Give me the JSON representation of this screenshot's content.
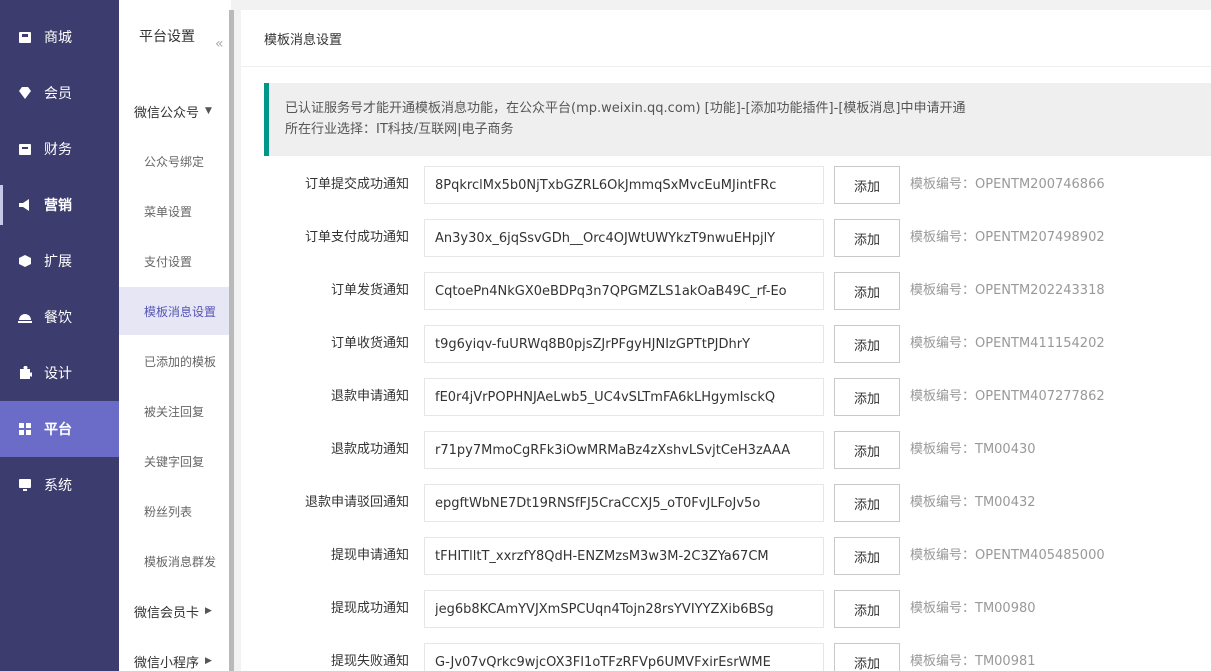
{
  "main_nav": [
    {
      "label": "商城",
      "icon": "shop-icon"
    },
    {
      "label": "会员",
      "icon": "diamond-icon"
    },
    {
      "label": "财务",
      "icon": "wallet-icon"
    },
    {
      "label": "营销",
      "icon": "megaphone-icon"
    },
    {
      "label": "扩展",
      "icon": "cube-icon"
    },
    {
      "label": "餐饮",
      "icon": "dish-icon"
    },
    {
      "label": "设计",
      "icon": "puzzle-icon"
    },
    {
      "label": "平台",
      "icon": "grid-icon",
      "active": true
    },
    {
      "label": "系统",
      "icon": "monitor-icon"
    }
  ],
  "sub_nav": {
    "title": "平台设置",
    "collapse": "«",
    "groups": [
      {
        "label": "微信公众号",
        "caret": "▼"
      },
      {
        "label": "微信会员卡",
        "caret": "▶"
      },
      {
        "label": "微信小程序",
        "caret": "▶"
      }
    ],
    "items": [
      {
        "label": "公众号绑定"
      },
      {
        "label": "菜单设置"
      },
      {
        "label": "支付设置"
      },
      {
        "label": "模板消息设置",
        "active": true
      },
      {
        "label": "已添加的模板"
      },
      {
        "label": "被关注回复"
      },
      {
        "label": "关键字回复"
      },
      {
        "label": "粉丝列表"
      },
      {
        "label": "模板消息群发"
      }
    ]
  },
  "page": {
    "title": "模板消息设置",
    "notice_line1": "已认证服务号才能开通模板消息功能，在公众平台(mp.weixin.qq.com) [功能]-[添加功能插件]-[模板消息]中申请开通",
    "notice_line2": "所在行业选择：IT科技/互联网|电子商务"
  },
  "rows": [
    {
      "label": "订单提交成功通知",
      "value": "8PqkrclMx5b0NjTxbGZRL6OkJmmqSxMvcEuMJintFRc",
      "button": "添加",
      "code": "模板编号：OPENTM200746866"
    },
    {
      "label": "订单支付成功通知",
      "value": "An3y30x_6jqSsvGDh__Orc4OJWtUWYkzT9nwuEHpjlY",
      "button": "添加",
      "code": "模板编号：OPENTM207498902"
    },
    {
      "label": "订单发货通知",
      "value": "CqtoePn4NkGX0eBDPq3n7QPGMZLS1akOaB49C_rf-Eo",
      "button": "添加",
      "code": "模板编号：OPENTM202243318"
    },
    {
      "label": "订单收货通知",
      "value": "t9g6yiqv-fuURWq8B0pjsZJrPFgyHJNIzGPTtPJDhrY",
      "button": "添加",
      "code": "模板编号：OPENTM411154202"
    },
    {
      "label": "退款申请通知",
      "value": "fE0r4jVrPOPHNJAeLwb5_UC4vSLTmFA6kLHgymIsckQ",
      "button": "添加",
      "code": "模板编号：OPENTM407277862"
    },
    {
      "label": "退款成功通知",
      "value": "r71py7MmoCgRFk3iOwMRMaBz4zXshvLSvjtCeH3zAAA",
      "button": "添加",
      "code": "模板编号：TM00430"
    },
    {
      "label": "退款申请驳回通知",
      "value": "epgftWbNE7Dt19RNSfFJ5CraCCXJ5_oT0FvJLFoJv5o",
      "button": "添加",
      "code": "模板编号：TM00432"
    },
    {
      "label": "提现申请通知",
      "value": "tFHITlltT_xxrzfY8QdH-ENZMzsM3w3M-2C3ZYa67CM",
      "button": "添加",
      "code": "模板编号：OPENTM405485000"
    },
    {
      "label": "提现成功通知",
      "value": "jeg6b8KCAmYVJXmSPCUqn4Tojn28rsYVIYYZXib6BSg",
      "button": "添加",
      "code": "模板编号：TM00980"
    },
    {
      "label": "提现失败通知",
      "value": "G-Jv07vQrkc9wjcOX3FI1oTFzRFVp6UMVFxirEsrWME",
      "button": "添加",
      "code": "模板编号：TM00981"
    }
  ]
}
